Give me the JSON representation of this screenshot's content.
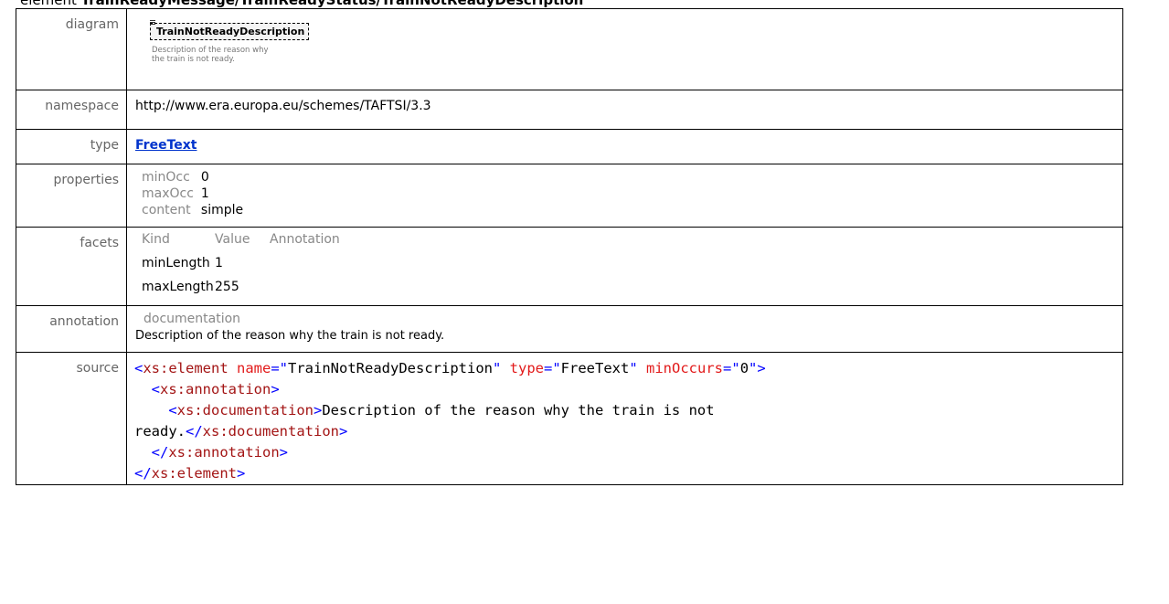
{
  "heading": {
    "prefix": "element",
    "path": "TrainReadyMessage/TrainReadyStatus/TrainNotReadyDescription"
  },
  "rows": {
    "diagram": {
      "label": "diagram",
      "element_name": "TrainNotReadyDescription",
      "element_desc_line1": "Description of the reason why",
      "element_desc_line2": "the train is not ready."
    },
    "namespace": {
      "label": "namespace",
      "value": "http://www.era.europa.eu/schemes/TAFTSI/3.3"
    },
    "type": {
      "label": "type",
      "value": "FreeText"
    },
    "properties": {
      "label": "properties",
      "items": [
        {
          "key": "minOcc",
          "value": "0"
        },
        {
          "key": "maxOcc",
          "value": "1"
        },
        {
          "key": "content",
          "value": "simple"
        }
      ]
    },
    "facets": {
      "label": "facets",
      "headers": [
        "Kind",
        "Value",
        "Annotation"
      ],
      "items": [
        {
          "kind": "minLength",
          "value": "1",
          "annotation": ""
        },
        {
          "kind": "maxLength",
          "value": "255",
          "annotation": ""
        }
      ]
    },
    "annotation": {
      "label": "annotation",
      "header": "documentation",
      "text": "Description of the reason why the train is not ready."
    },
    "source": {
      "label": "source",
      "l1_open": "<",
      "l1_tag": "xs:element",
      "l1_attr1": "name",
      "l1_eq1": "=\"",
      "l1_val1": "TrainNotReadyDescription",
      "l1_q1": "\"",
      "l1_attr2": "type",
      "l1_eq2": "=\"",
      "l1_val2": "FreeText",
      "l1_q2": "\"",
      "l1_attr3": "minOccurs",
      "l1_eq3": "=\"",
      "l1_val3": "0",
      "l1_q3": "\"",
      "l1_close": ">",
      "l2_open": "<",
      "l2_tag": "xs:annotation",
      "l2_close": ">",
      "l3_open": "<",
      "l3_tag": "xs:documentation",
      "l3_close": ">",
      "l3_text": "Description of the reason why the train is not",
      "l4_text": "ready.",
      "l4_open": "</",
      "l4_tag": "xs:documentation",
      "l4_close": ">",
      "l5_open": "</",
      "l5_tag": "xs:annotation",
      "l5_close": ">",
      "l6_open": "</",
      "l6_tag": "xs:element",
      "l6_close": ">"
    }
  }
}
